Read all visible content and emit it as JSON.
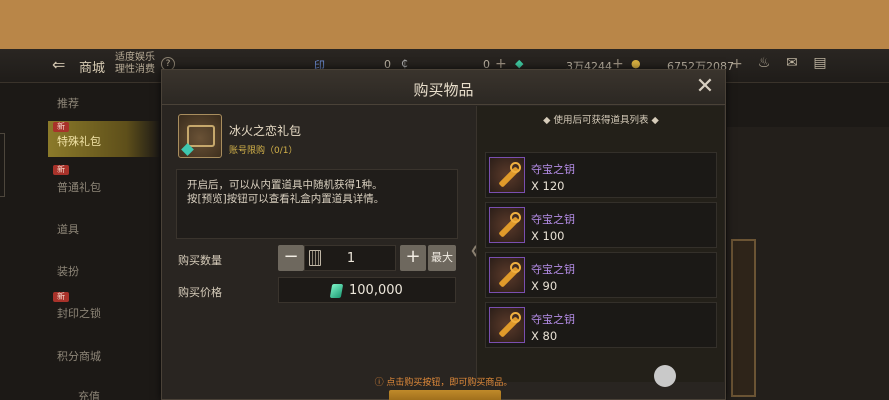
{
  "topbar": {
    "back_icon": "back-arrow-icon",
    "title": "商城",
    "healthy_gaming": "适度娱乐\n理性消费",
    "currencies": [
      {
        "icon": "points-icon",
        "value": "0"
      },
      {
        "icon": "coupon-icon",
        "value": "0"
      },
      {
        "icon": "gem-icon",
        "value": "3万4244"
      },
      {
        "icon": "gold-icon",
        "value": "6752万2087"
      }
    ],
    "icons": [
      "pot-icon",
      "mail-icon",
      "chat-icon"
    ]
  },
  "sidebar": {
    "items": [
      {
        "label": "推荐",
        "badge": "",
        "active": false
      },
      {
        "label": "特殊礼包",
        "badge": "新",
        "active": true
      },
      {
        "label": "普通礼包",
        "badge": "新",
        "active": false
      },
      {
        "label": "道具",
        "badge": "",
        "active": false
      },
      {
        "label": "装扮",
        "badge": "",
        "active": false
      },
      {
        "label": "封印之锁",
        "badge": "新",
        "active": false
      },
      {
        "label": "积分商城",
        "badge": "",
        "active": false
      },
      {
        "label": "充值",
        "badge": "",
        "active": false
      }
    ]
  },
  "dialog": {
    "title": "购买物品",
    "close_icon": "close-icon",
    "package": {
      "name": "冰火之恋礼包",
      "limit": "账号限购（0/1）",
      "description_line1": "开启后，可以从内置道具中随机获得1种。",
      "description_line2": "按[预览]按钮可以查看礼盒内置道具详情。"
    },
    "quantity": {
      "label": "购买数量",
      "minus": "−",
      "value": "1",
      "plus": "+",
      "max": "最大"
    },
    "price": {
      "label": "购买价格",
      "value": "100,000"
    },
    "rewards": {
      "title": "◆ 使用后可获得道具列表 ◆",
      "items": [
        {
          "name": "夺宝之钥",
          "qty": "X 120"
        },
        {
          "name": "夺宝之钥",
          "qty": "X 100"
        },
        {
          "name": "夺宝之钥",
          "qty": "X 90"
        },
        {
          "name": "夺宝之钥",
          "qty": "X 80"
        }
      ]
    },
    "hint": "ⓘ 点击购买按钮，即可购买商品。"
  },
  "colors": {
    "accent_gold": "#d2b14a",
    "reward_name": "#b58de8",
    "hint_orange": "#e08a3a",
    "top_band": "#b98648"
  }
}
